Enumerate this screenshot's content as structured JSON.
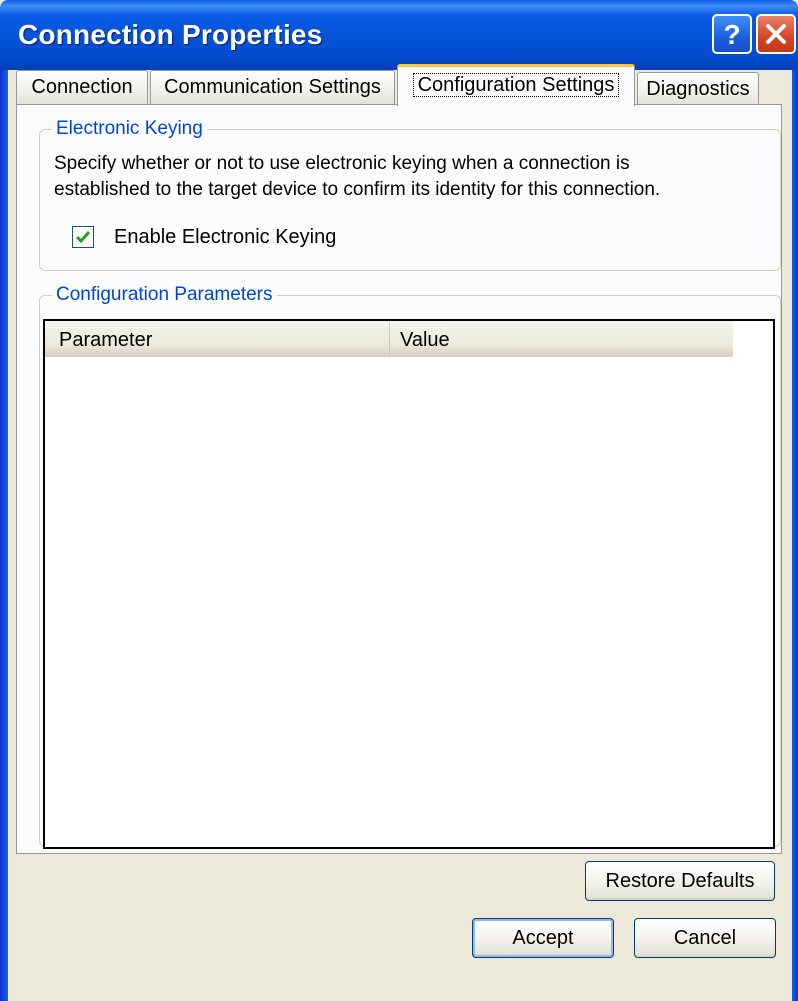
{
  "window": {
    "title": "Connection Properties",
    "help_button": "?",
    "close_button": "×"
  },
  "tabs": [
    {
      "label": "Connection",
      "active": false
    },
    {
      "label": "Communication Settings",
      "active": false
    },
    {
      "label": "Configuration Settings",
      "active": true
    },
    {
      "label": "Diagnostics",
      "active": false
    }
  ],
  "electronic_keying": {
    "legend": "Electronic Keying",
    "description_line1": "Specify whether or not to use electronic keying when a connection is",
    "description_line2": "established to the target device to confirm its identity for this connection.",
    "checkbox_label": "Enable Electronic Keying",
    "checked": true
  },
  "configuration_parameters": {
    "legend": "Configuration Parameters",
    "columns": [
      "Parameter",
      "Value"
    ],
    "rows": [],
    "restore_defaults_label": "Restore Defaults"
  },
  "footer": {
    "accept_label": "Accept",
    "cancel_label": "Cancel"
  },
  "colors": {
    "titlebar": "#0a5ce8",
    "accent_legend": "#0046d5",
    "active_tab_highlight": "#ffc73c",
    "checkmark": "#21a121"
  }
}
